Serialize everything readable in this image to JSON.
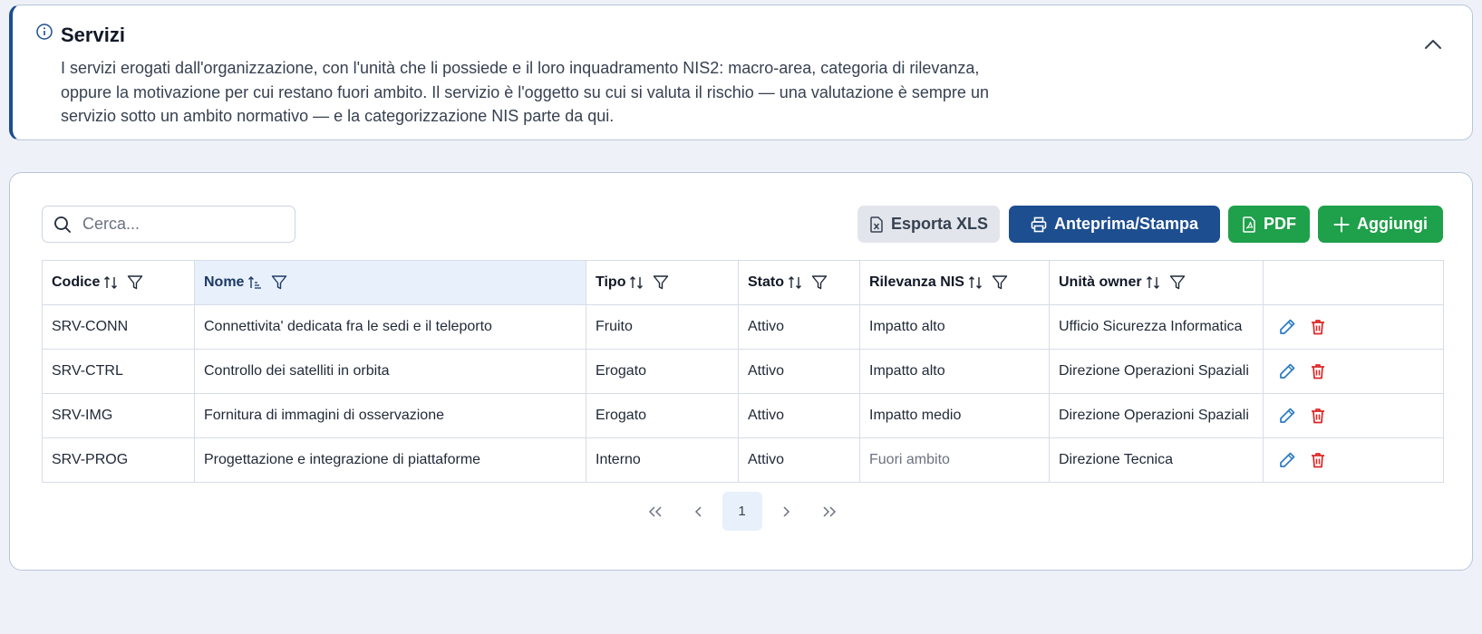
{
  "info": {
    "title": "Servizi",
    "description": "I servizi erogati dall'organizzazione, con l'unità che li possiede e il loro inquadramento NIS2: macro-area, categoria di rilevanza, oppure la motivazione per cui restano fuori ambito. Il servizio è l'oggetto su cui si valuta il rischio — una valutazione è sempre un servizio sotto un ambito normativo — e la categorizzazione NIS parte da qui."
  },
  "toolbar": {
    "search_placeholder": "Cerca...",
    "export_xls": "Esporta XLS",
    "print": "Anteprima/Stampa",
    "pdf": "PDF",
    "add": "Aggiungi"
  },
  "table": {
    "headers": {
      "codice": "Codice",
      "nome": "Nome",
      "tipo": "Tipo",
      "stato": "Stato",
      "rilevanza": "Rilevanza NIS",
      "unita": "Unità owner"
    },
    "rows": [
      {
        "codice": "SRV-CONN",
        "nome": "Connettivita' dedicata fra le sedi e il teleporto",
        "tipo": "Fruito",
        "stato": "Attivo",
        "rilevanza": "Impatto alto",
        "unita": "Ufficio Sicurezza Informatica"
      },
      {
        "codice": "SRV-CTRL",
        "nome": "Controllo dei satelliti in orbita",
        "tipo": "Erogato",
        "stato": "Attivo",
        "rilevanza": "Impatto alto",
        "unita": "Direzione Operazioni Spaziali"
      },
      {
        "codice": "SRV-IMG",
        "nome": "Fornitura di immagini di osservazione",
        "tipo": "Erogato",
        "stato": "Attivo",
        "rilevanza": "Impatto medio",
        "unita": "Direzione Operazioni Spaziali"
      },
      {
        "codice": "SRV-PROG",
        "nome": "Progettazione e integrazione di piattaforme",
        "tipo": "Interno",
        "stato": "Attivo",
        "rilevanza": "Fuori ambito",
        "unita": "Direzione Tecnica"
      }
    ]
  },
  "pagination": {
    "current_page": "1"
  },
  "colors": {
    "primary": "#1d4e8f",
    "success": "#1fa04a",
    "danger": "#dc2626",
    "edit": "#2b7bc4",
    "background": "#eef2f8"
  },
  "icons": [
    "info-icon",
    "chevron-up-icon",
    "search-icon",
    "excel-file-icon",
    "printer-icon",
    "pdf-file-icon",
    "plus-icon",
    "sort-icon",
    "sort-asc-icon",
    "filter-icon",
    "pencil-icon",
    "trash-icon",
    "double-chevron-left-icon",
    "chevron-left-icon",
    "chevron-right-icon",
    "double-chevron-right-icon"
  ]
}
